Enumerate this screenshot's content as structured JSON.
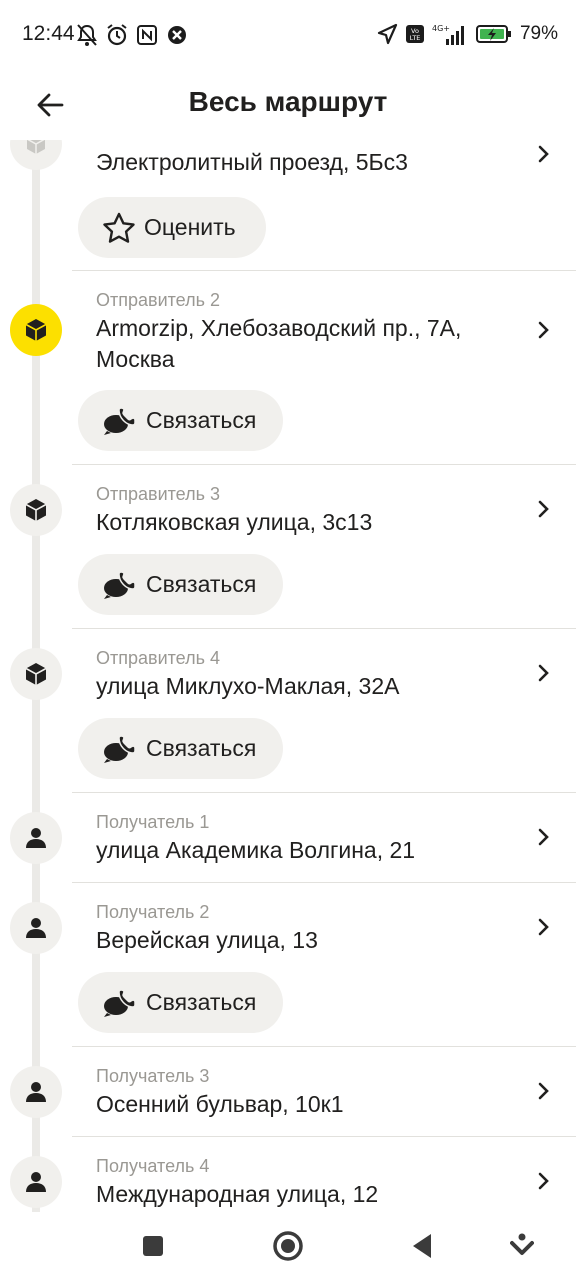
{
  "status_bar": {
    "time": "12:44",
    "battery": "79%"
  },
  "header": {
    "title": "Весь маршрут"
  },
  "colors": {
    "accent": "#fce000",
    "pill_bg": "#f1f0ed",
    "muted_text": "#9a9893",
    "timeline": "#ebeae7"
  },
  "route": {
    "items": [
      {
        "label": "",
        "address": "Электролитный проезд, 5Бс3",
        "action": "Оценить",
        "icon": "box-icon"
      },
      {
        "label": "Отправитель 2",
        "address": "Armorzip, Хлебозаводский пр., 7А, Москва",
        "action": "Связаться",
        "icon": "box-icon"
      },
      {
        "label": "Отправитель 3",
        "address": "Котляковская улица, 3с13",
        "action": "Связаться",
        "icon": "box-icon"
      },
      {
        "label": "Отправитель 4",
        "address": "улица Миклухо-Маклая, 32А",
        "action": "Связаться",
        "icon": "box-icon"
      },
      {
        "label": "Получатель 1",
        "address": "улица Академика Волгина, 21",
        "icon": "person-icon"
      },
      {
        "label": "Получатель 2",
        "address": "Верейская улица, 13",
        "action": "Связаться",
        "icon": "person-icon"
      },
      {
        "label": "Получатель 3",
        "address": "Осенний бульвар, 10к1",
        "icon": "person-icon"
      },
      {
        "label": "Получатель 4",
        "address": "Международная улица, 12",
        "icon": "person-icon"
      }
    ]
  }
}
